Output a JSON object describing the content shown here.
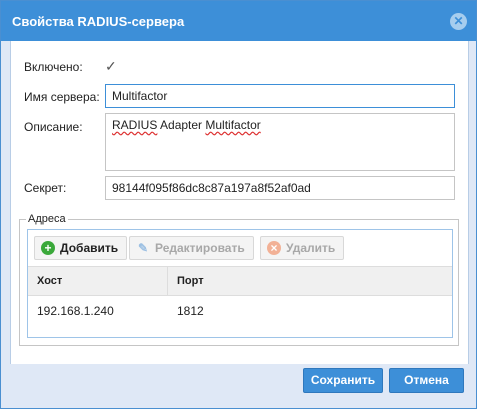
{
  "dialog": {
    "title": "Свойства RADIUS-сервера",
    "close_icon": "close-icon"
  },
  "form": {
    "enabled_label": "Включено:",
    "enabled_checked": true,
    "server_name_label": "Имя сервера:",
    "server_name_value": "Multifactor",
    "description_label": "Описание:",
    "description_value_part1": "RADIUS",
    "description_value_part2": " Adapter ",
    "description_value_part3": "Multifactor",
    "secret_label": "Секрет:",
    "secret_value": "98144f095f86dc8c87a197a8f52af0ad"
  },
  "addresses": {
    "legend": "Адреса",
    "toolbar": {
      "add_label": "Добавить",
      "edit_label": "Редактировать",
      "delete_label": "Удалить"
    },
    "columns": [
      "Хост",
      "Порт"
    ],
    "rows": [
      {
        "host": "192.168.1.240",
        "port": "1812"
      }
    ]
  },
  "footer": {
    "save_label": "Сохранить",
    "cancel_label": "Отмена"
  },
  "colors": {
    "accent": "#3d8fd8",
    "add_icon": "#3aa83a",
    "edit_icon": "#9cc0e3",
    "delete_icon": "#f2b196"
  }
}
